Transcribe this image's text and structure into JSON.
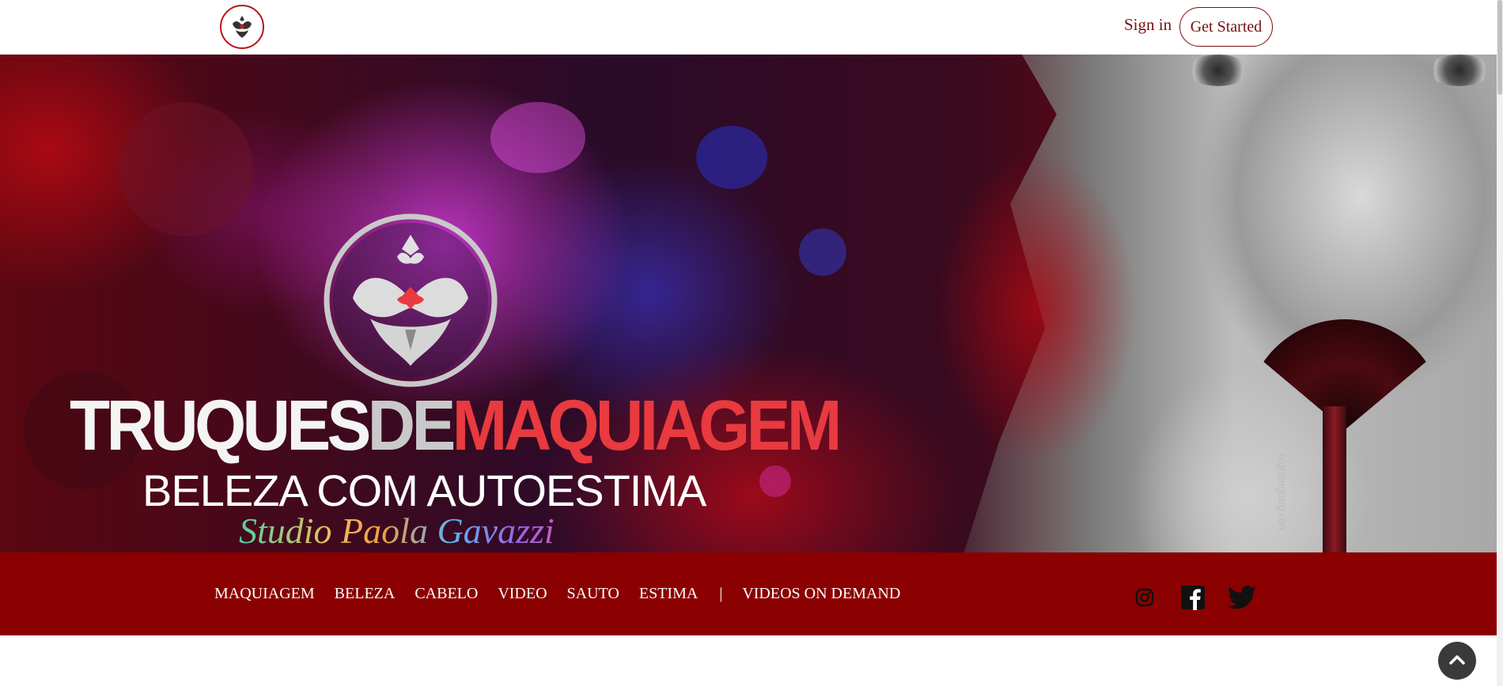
{
  "header": {
    "logo_icon": "studio-paola-gavazzi-emblem-icon",
    "signin_label": "Sign in",
    "get_started_label": "Get Started",
    "accent_color": "#7a0e0e"
  },
  "hero": {
    "brand_words": [
      "TRUQUES",
      "DE",
      "MAQUIAGEM"
    ],
    "tagline": "BELEZA COM AUTOESTIMA",
    "signature": "Studio Paola Gavazzi",
    "brush_engraving": "nightingung ran"
  },
  "nav": {
    "background": "#8b0000",
    "items": [
      {
        "label": "MAQUIAGEM"
      },
      {
        "label": "BELEZA"
      },
      {
        "label": "CABELO"
      },
      {
        "label": "VIDEO"
      },
      {
        "label": "SAUTO"
      },
      {
        "label": "ESTIMA"
      }
    ],
    "separator": "|",
    "vod_label": "VIDEOS ON DEMAND",
    "social": [
      "instagram-icon",
      "facebook-icon",
      "twitter-icon"
    ]
  },
  "back_to_top_icon": "chevron-up-icon"
}
